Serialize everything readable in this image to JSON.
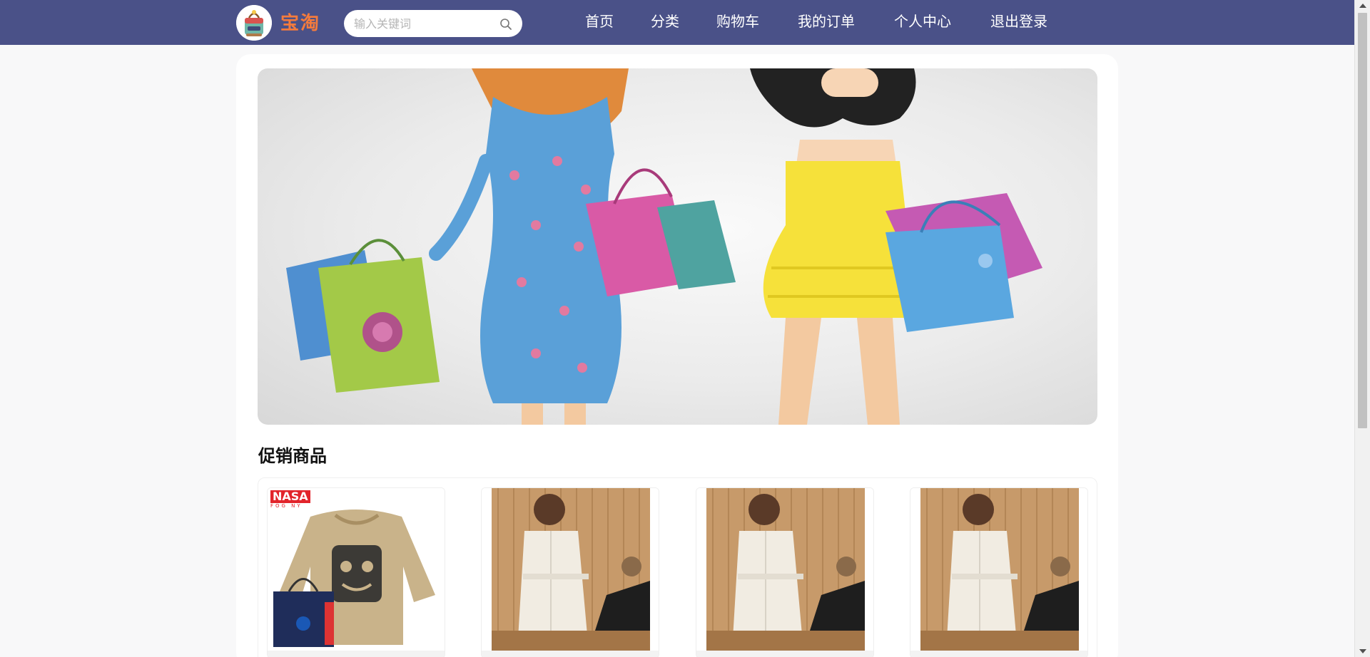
{
  "header": {
    "brand": "宝淘",
    "search": {
      "placeholder": "输入关键词",
      "value": ""
    },
    "nav": [
      "首页",
      "分类",
      "购物车",
      "我的订单",
      "个人中心",
      "退出登录"
    ]
  },
  "banner": {
    "slide_count": 2,
    "active_slide": 2
  },
  "promotions": {
    "title": "促销商品",
    "badge_text": "NASA",
    "badge_sub": "FOG NY"
  },
  "colors": {
    "header_bg": "#4a5188",
    "brand": "#f47b3d",
    "dot_active": "#e03a2f",
    "dot_inactive": "#b0b0b0"
  },
  "icons": {
    "logo": "bag-logo-icon",
    "search": "search-icon"
  }
}
